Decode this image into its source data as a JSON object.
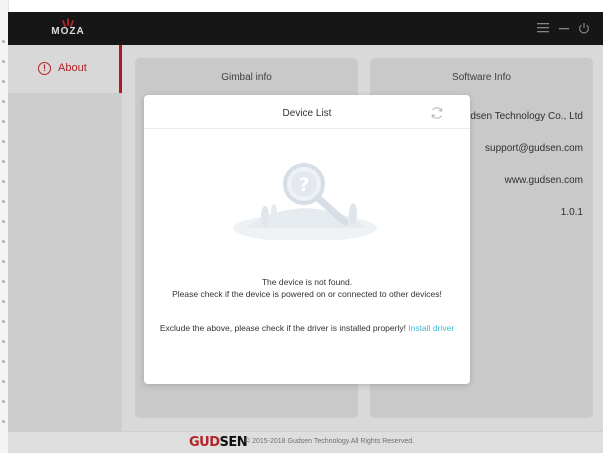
{
  "titlebar": {
    "logo_text": "MOZA",
    "icons": [
      "menu-icon",
      "minimize-icon",
      "power-icon"
    ]
  },
  "sidebar": {
    "items": [
      {
        "label": "About",
        "icon": "info-icon",
        "active": true
      }
    ]
  },
  "cards": {
    "gimbal": {
      "title": "Gimbal info"
    },
    "software": {
      "title": "Software Info",
      "company": "udsen Technology Co., Ltd",
      "email": "support@gudsen.com",
      "website": "www.gudsen.com",
      "version": "1.0.1"
    }
  },
  "dialog": {
    "title": "Device List",
    "not_found": "The device is not found.",
    "check_hint": "Please check if the device is powered on or connected to other devices!",
    "driver_hint": "Exclude the above, please check if the driver is installed properly!",
    "install_link": "Install driver"
  },
  "footer": {
    "brand_part1": "GUD",
    "brand_part2": "SEN",
    "copyright": "© 2015-2018 Gudsen Technology.All Rights Reserved."
  },
  "colors": {
    "titlebar": "#181818",
    "accent": "#c0262c",
    "link": "#3fbcd4",
    "card": "#d6d6d6",
    "background": "#e7e7e7"
  }
}
